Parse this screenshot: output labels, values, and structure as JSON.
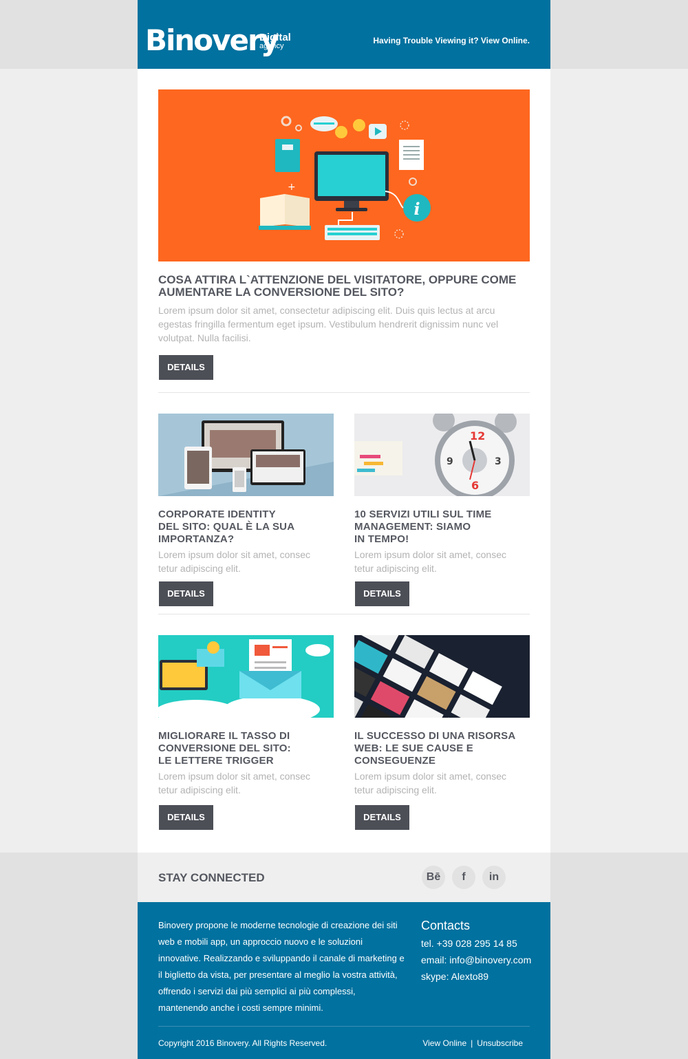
{
  "header": {
    "logo_main": "Binovery",
    "logo_sub1": "Digital",
    "logo_sub2": "agency",
    "view_online": "Having Trouble Viewing it? View Online."
  },
  "colors": {
    "brand_blue": "#01719f",
    "hero_orange": "#fe671f",
    "button_dark": "#4d4f57",
    "heading_gray": "#555860",
    "text_gray": "#b3b3b3"
  },
  "hero": {
    "title": "COSA ATTIRA L`ATTENZIONE DEL VISITATORE, OPPURE COME AUMENTARE LA CONVERSIONE DEL SITO?",
    "text": "Lorem ipsum dolor sit amet, consectetur adipiscing elit. Duis quis lectus at arcu egestas fringilla fermentum eget ipsum. Vestibulum hendrerit dignissim nunc vel volutpat. Nulla facilisi.",
    "button": "DETAILS"
  },
  "cards": [
    {
      "title": "CORPORATE IDENTITY\nDEL SITO: QUAL È LA SUA\nIMPORTANZA?",
      "text": "Lorem ipsum dolor sit amet, consec\ntetur adipiscing elit.",
      "button": "DETAILS"
    },
    {
      "title": "10 SERVIZI UTILI SUL TIME\nMANAGEMENT: SIAMO\nIN TEMPO!",
      "text": "Lorem ipsum dolor sit amet, consec\ntetur adipiscing elit.",
      "button": "DETAILS"
    },
    {
      "title": "MIGLIORARE IL TASSO DI\nCONVERSIONE DEL SITO:\nLE LETTERE TRIGGER",
      "text": "Lorem ipsum dolor sit amet, consec\ntetur adipiscing elit.",
      "button": "DETAILS"
    },
    {
      "title": "IL SUCCESSO DI UNA RISORSA\nWEB: LE SUE CAUSE E\nCONSEGUENZE",
      "text": "Lorem ipsum dolor sit amet, consec\ntetur adipiscing elit.",
      "button": "DETAILS"
    }
  ],
  "social": {
    "title": "STAY CONNECTED",
    "icons": [
      {
        "name": "behance-icon",
        "glyph": "Bē"
      },
      {
        "name": "facebook-icon",
        "glyph": "f"
      },
      {
        "name": "linkedin-icon",
        "glyph": "in"
      }
    ]
  },
  "footer": {
    "about": "Binovery propone le moderne tecnologie di creazione dei siti web e mobili app, un approccio nuovo e le soluzioni innovative. Realizzando e sviluppando il canale di marketing e il biglietto da vista, per presentare al meglio la vostra attività, offrendo i servizi dai più semplici ai più complessi, mantenendo anche i costi sempre minimi.",
    "contacts_title": "Contacts",
    "phone": "tel. +39 028 295 14 85",
    "email": "email: info@binovery.com",
    "skype": "skype: Alexto89",
    "copyright": "Copyright 2016 Binovery. All Rights Reserved.",
    "view_online": "View Online",
    "separator": "|",
    "unsubscribe": "Unsubscribe"
  }
}
